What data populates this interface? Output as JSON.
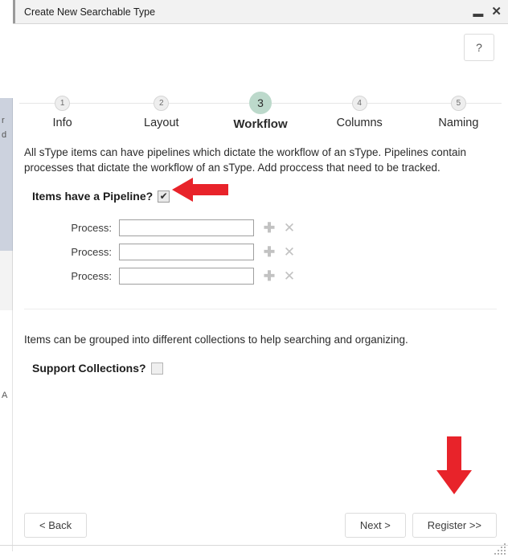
{
  "window": {
    "title": "Create New Searchable Type",
    "minimize_icon": "minimize-icon",
    "close_icon": "close-icon",
    "minimize_glyph": "▬",
    "close_glyph": "✕"
  },
  "help": {
    "label": "?"
  },
  "stepper": {
    "active_step": 3,
    "accent_color": "#bcd9cb",
    "steps": [
      {
        "number": "1",
        "label": "Info"
      },
      {
        "number": "2",
        "label": "Layout"
      },
      {
        "number": "3",
        "label": "Workflow"
      },
      {
        "number": "4",
        "label": "Columns"
      },
      {
        "number": "5",
        "label": "Naming"
      }
    ]
  },
  "pipeline_section": {
    "description": "All sType items can have pipelines which dictate the workflow of an sType. Pipelines contain processes that dictate the workflow of an sType. Add proccess that need to be tracked.",
    "checkbox_label": "Items have a Pipeline?",
    "checkbox_checked": true,
    "check_glyph": "✔",
    "processes": [
      {
        "label": "Process:",
        "value": "",
        "add_icon": "plus-icon",
        "remove_icon": "close-icon"
      },
      {
        "label": "Process:",
        "value": "",
        "add_icon": "plus-icon",
        "remove_icon": "close-icon"
      },
      {
        "label": "Process:",
        "value": "",
        "add_icon": "plus-icon",
        "remove_icon": "close-icon"
      }
    ],
    "add_glyph": "✚",
    "remove_glyph": "✕"
  },
  "collections_section": {
    "description": "Items can be grouped into different collections to help searching and organizing.",
    "checkbox_label": "Support Collections?",
    "checkbox_checked": false
  },
  "footer": {
    "back_label": "< Back",
    "next_label": "Next >",
    "register_label": "Register >>"
  },
  "annotations": {
    "color": "#e8232a",
    "arrow_to_checkbox": "left-arrow",
    "arrow_to_register": "down-arrow"
  },
  "background_window": {
    "ghost_lines": [
      "r",
      "d",
      "A"
    ]
  }
}
